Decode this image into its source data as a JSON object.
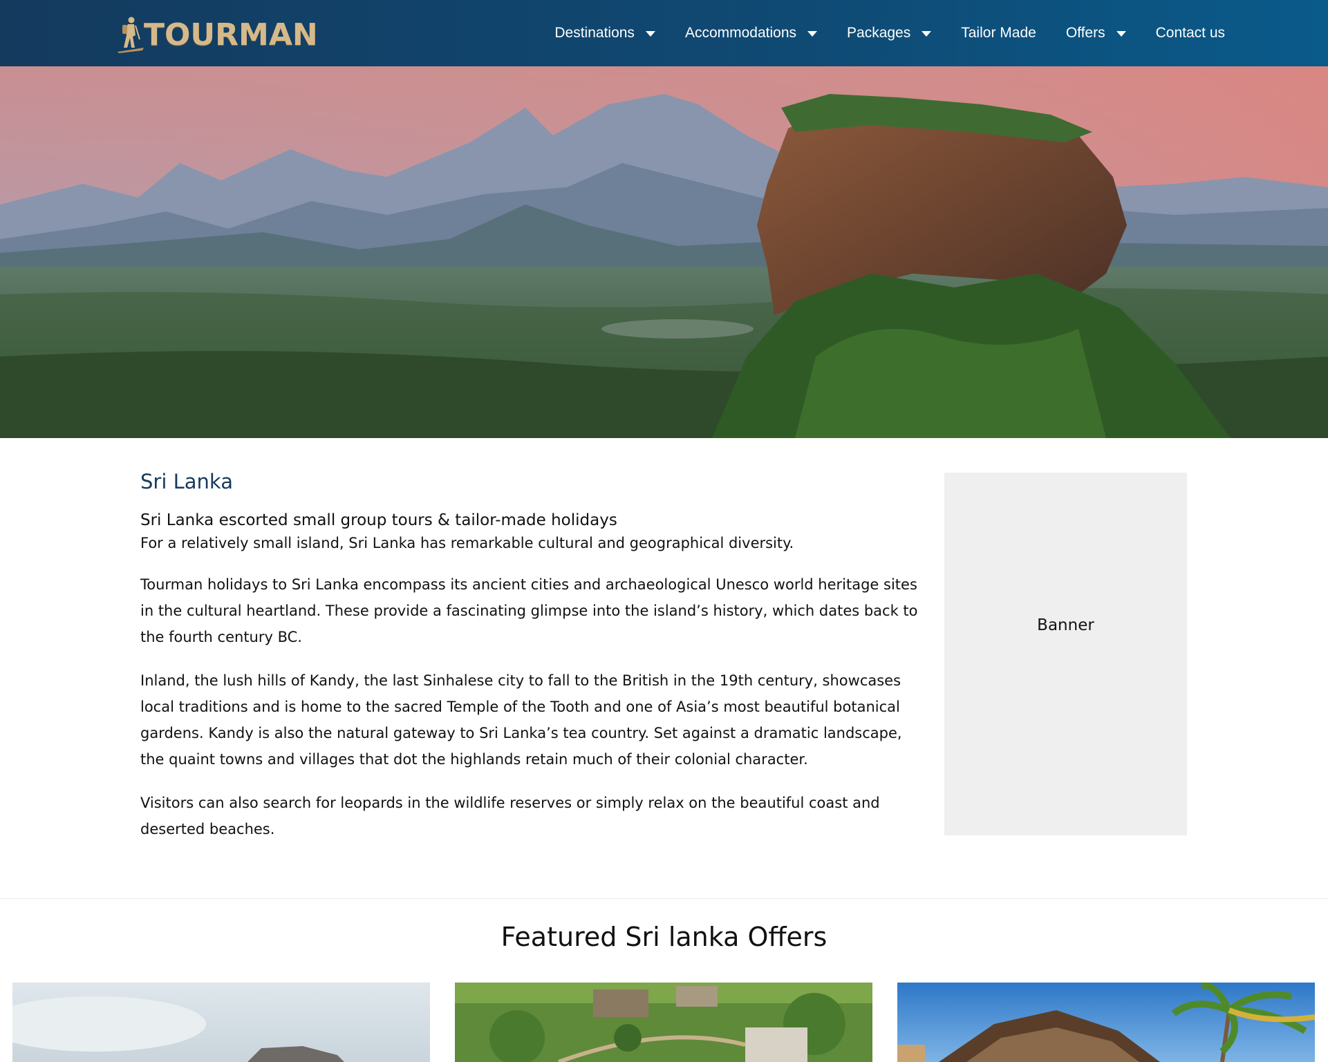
{
  "brand": {
    "logo_text": "TOURMAN"
  },
  "nav": {
    "items": [
      {
        "label": "Destinations",
        "dropdown": true
      },
      {
        "label": "Accommodations",
        "dropdown": true
      },
      {
        "label": "Packages",
        "dropdown": true
      },
      {
        "label": "Tailor Made",
        "dropdown": false
      },
      {
        "label": "Offers",
        "dropdown": true
      },
      {
        "label": "Contact us",
        "dropdown": false
      }
    ]
  },
  "hero": {
    "image": "sigiriya-rock-landscape"
  },
  "main": {
    "title": "Sri Lanka",
    "subtitle": "Sri Lanka escorted small group tours & tailor-made holidays",
    "paragraphs": [
      "For a relatively small island, Sri Lanka has remarkable cultural and geographical diversity.",
      "Tourman holidays to Sri Lanka encompass its ancient cities and archaeological Unesco world heritage sites in the cultural heartland. These provide a fascinating glimpse into the island’s history, which dates back to the fourth century BC.",
      "Inland, the lush hills of Kandy, the last Sinhalese city to fall to the British in the 19th century, showcases local traditions and is home to the sacred Temple of the Tooth and one of Asia’s most beautiful botanical gardens. Kandy is also the natural gateway to Sri Lanka’s tea country. Set against a dramatic landscape, the quaint towns and villages that dot the highlands retain much of their colonial character.",
      "Visitors can also search for leopards in the wildlife reserves or simply relax on the beautiful coast and deserted beaches."
    ]
  },
  "sidebar": {
    "banner_label": "Banner"
  },
  "featured": {
    "title": "Featured Sri lanka Offers",
    "offers": [
      {
        "image": "resort-building-sky"
      },
      {
        "image": "villa-aerial-garden"
      },
      {
        "image": "beach-resort-palm"
      }
    ]
  },
  "colors": {
    "header_bg": "#143a5e",
    "accent_title": "#173a5e",
    "logo_gold": "#d6b98a",
    "banner_bg": "#efefef"
  }
}
